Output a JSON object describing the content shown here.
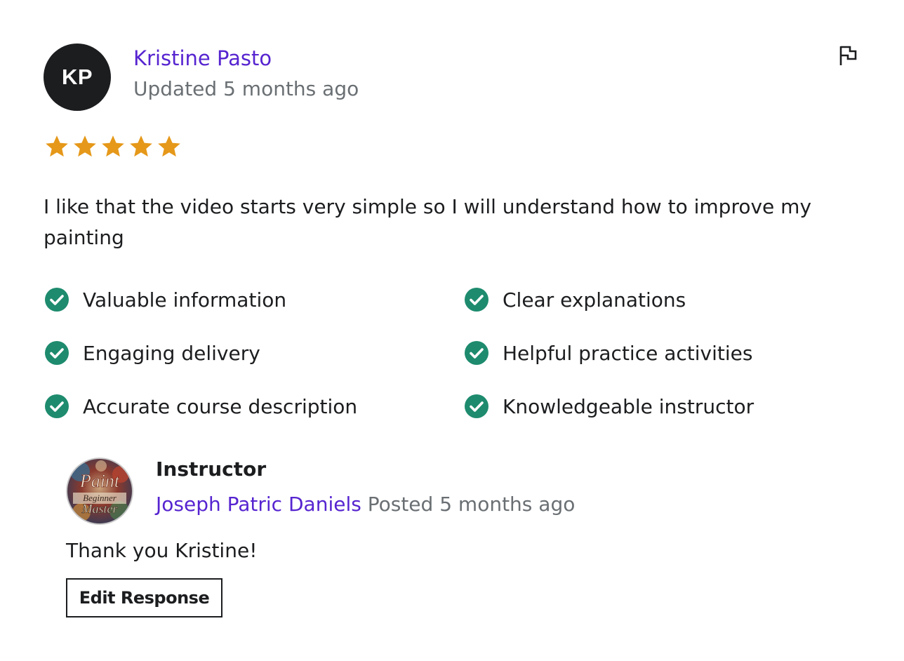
{
  "review": {
    "avatar_initials": "KP",
    "avatar_color": "#1c1d1f",
    "reviewer_name": "Kristine Pasto",
    "date": "Updated 5 months ago",
    "rating": 5,
    "rating_max": 5,
    "star_color": "#e59819",
    "flag_icon": "flag-icon",
    "text": "I like that the video starts very simple so I will understand how to improve my painting",
    "features": [
      {
        "label": "Valuable information",
        "icon": "check-circle-icon"
      },
      {
        "label": "Clear explanations",
        "icon": "check-circle-icon"
      },
      {
        "label": "Engaging delivery",
        "icon": "check-circle-icon"
      },
      {
        "label": "Helpful practice activities",
        "icon": "check-circle-icon"
      },
      {
        "label": "Accurate course description",
        "icon": "check-circle-icon"
      },
      {
        "label": "Knowledgeable instructor",
        "icon": "check-circle-icon"
      }
    ],
    "check_color": "#1e8b6e"
  },
  "response": {
    "role": "Instructor",
    "instructor_name": "Joseph Patric Daniels",
    "posted": "Posted 5 months ago",
    "logo_lines": [
      "Paint",
      "Beginner",
      "Master"
    ],
    "text": "Thank you Kristine!",
    "edit_label": "Edit Response"
  },
  "colors": {
    "link": "#5624d0",
    "muted": "#6a6f73",
    "text": "#1c1d1f"
  }
}
